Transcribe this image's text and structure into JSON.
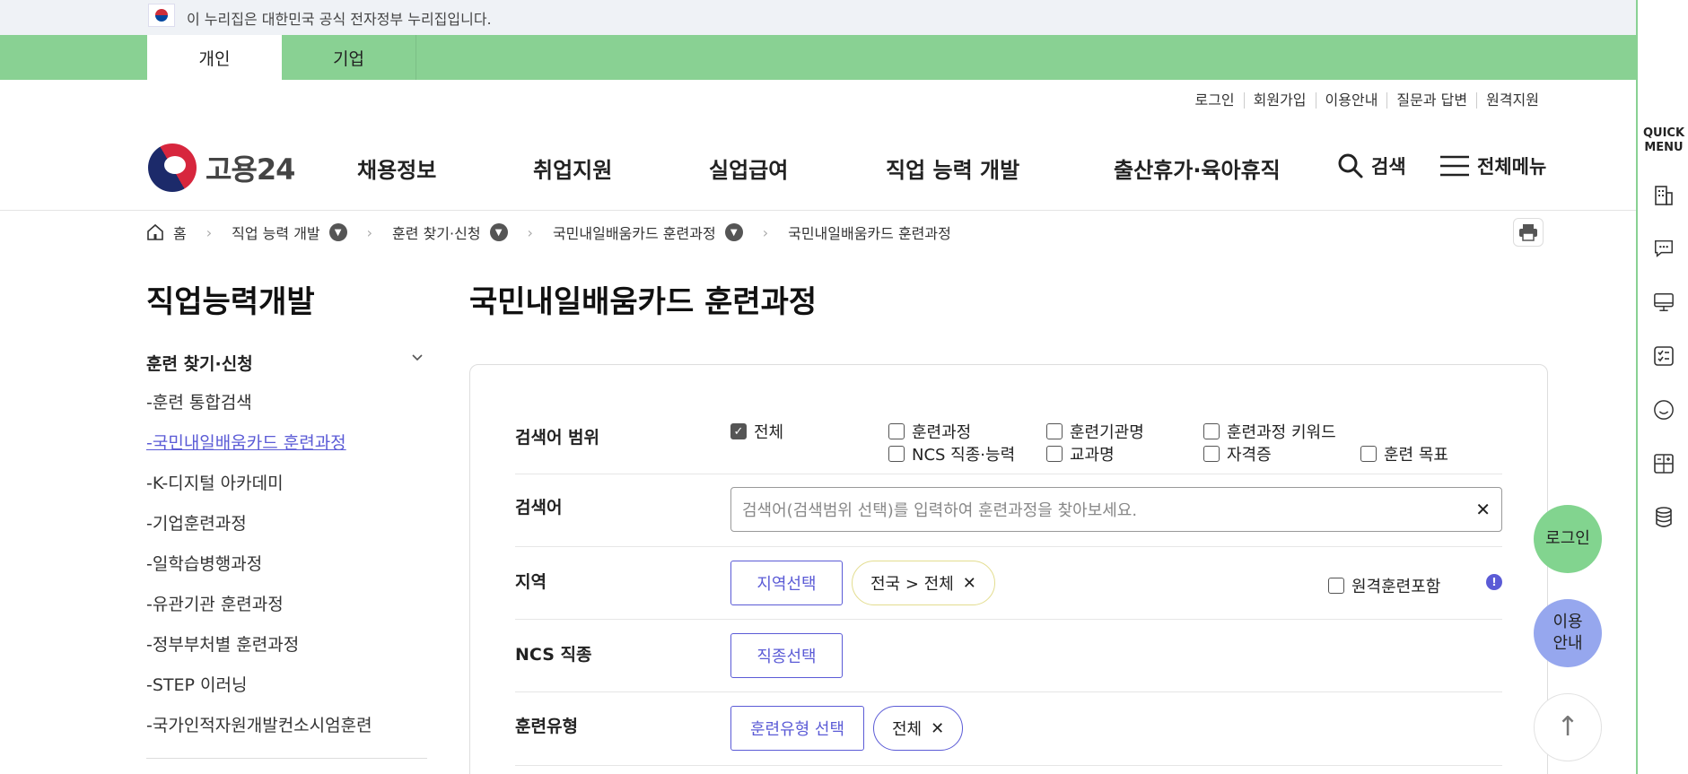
{
  "gov_banner": {
    "text": "이 누리집은 대한민국 공식 전자정부 누리집입니다."
  },
  "user_tabs": [
    {
      "label": "개인",
      "active": true
    },
    {
      "label": "기업",
      "active": false
    }
  ],
  "utility_links": [
    "로그인",
    "회원가입",
    "이용안내",
    "질문과 답변",
    "원격지원"
  ],
  "logo": {
    "text": "고용24"
  },
  "gnb": [
    "채용정보",
    "취업지원",
    "실업급여",
    "직업 능력 개발",
    "출산휴가·육아휴직"
  ],
  "header_actions": {
    "search": "검색",
    "all_menu": "전체메뉴"
  },
  "breadcrumb": [
    "홈",
    "직업 능력 개발",
    "훈련 찾기·신청",
    "국민내일배움카드 훈련과정",
    "국민내일배움카드 훈련과정"
  ],
  "sidebar": {
    "title": "직업능력개발",
    "group": "훈련 찾기·신청",
    "items": [
      {
        "label": "-훈련 통합검색"
      },
      {
        "label": "-국민내일배움카드 훈련과정",
        "active": true
      },
      {
        "label": "-K-디지털 아카데미"
      },
      {
        "label": "-기업훈련과정"
      },
      {
        "label": "-일학습병행과정"
      },
      {
        "label": "-유관기관 훈련과정"
      },
      {
        "label": "-정부부처별 훈련과정"
      },
      {
        "label": "-STEP 이러닝"
      },
      {
        "label": "-국가인적자원개발컨소시엄훈련"
      }
    ]
  },
  "main": {
    "title": "국민내일배움카드 훈련과정",
    "scope": {
      "label": "검색어 범위",
      "options": [
        {
          "label": "전체",
          "checked": true
        },
        {
          "label": "훈련과정",
          "checked": false
        },
        {
          "label": "훈련기관명",
          "checked": false
        },
        {
          "label": "훈련과정 키워드",
          "checked": false
        },
        {
          "label": "NCS 직종·능력",
          "checked": false
        },
        {
          "label": "교과명",
          "checked": false
        },
        {
          "label": "자격증",
          "checked": false
        },
        {
          "label": "훈련 목표",
          "checked": false
        }
      ]
    },
    "keyword": {
      "label": "검색어",
      "placeholder": "검색어(검색범위 선택)를 입력하여 훈련과정을 찾아보세요.",
      "value": ""
    },
    "region": {
      "label": "지역",
      "button": "지역선택",
      "chip": "전국 > 전체",
      "remote_label": "원격훈련포함",
      "remote_checked": false
    },
    "ncs": {
      "label": "NCS 직종",
      "button": "직종선택"
    },
    "train_type": {
      "label": "훈련유형",
      "button": "훈련유형 선택",
      "chip": "전체"
    }
  },
  "quick_menu": {
    "title_line1": "QUICK",
    "title_line2": "MENU",
    "icons": [
      "building-icon",
      "chat-icon",
      "monitor-icon",
      "checklist-icon",
      "smile-icon",
      "calculator-icon",
      "coins-icon"
    ]
  },
  "floating": {
    "login": "로그인",
    "guide_line1": "이용",
    "guide_line2": "안내",
    "top": "↑"
  },
  "colors": {
    "green": "#89d193",
    "accent": "#5b5bd6",
    "fab_guide": "#96a7ee"
  }
}
